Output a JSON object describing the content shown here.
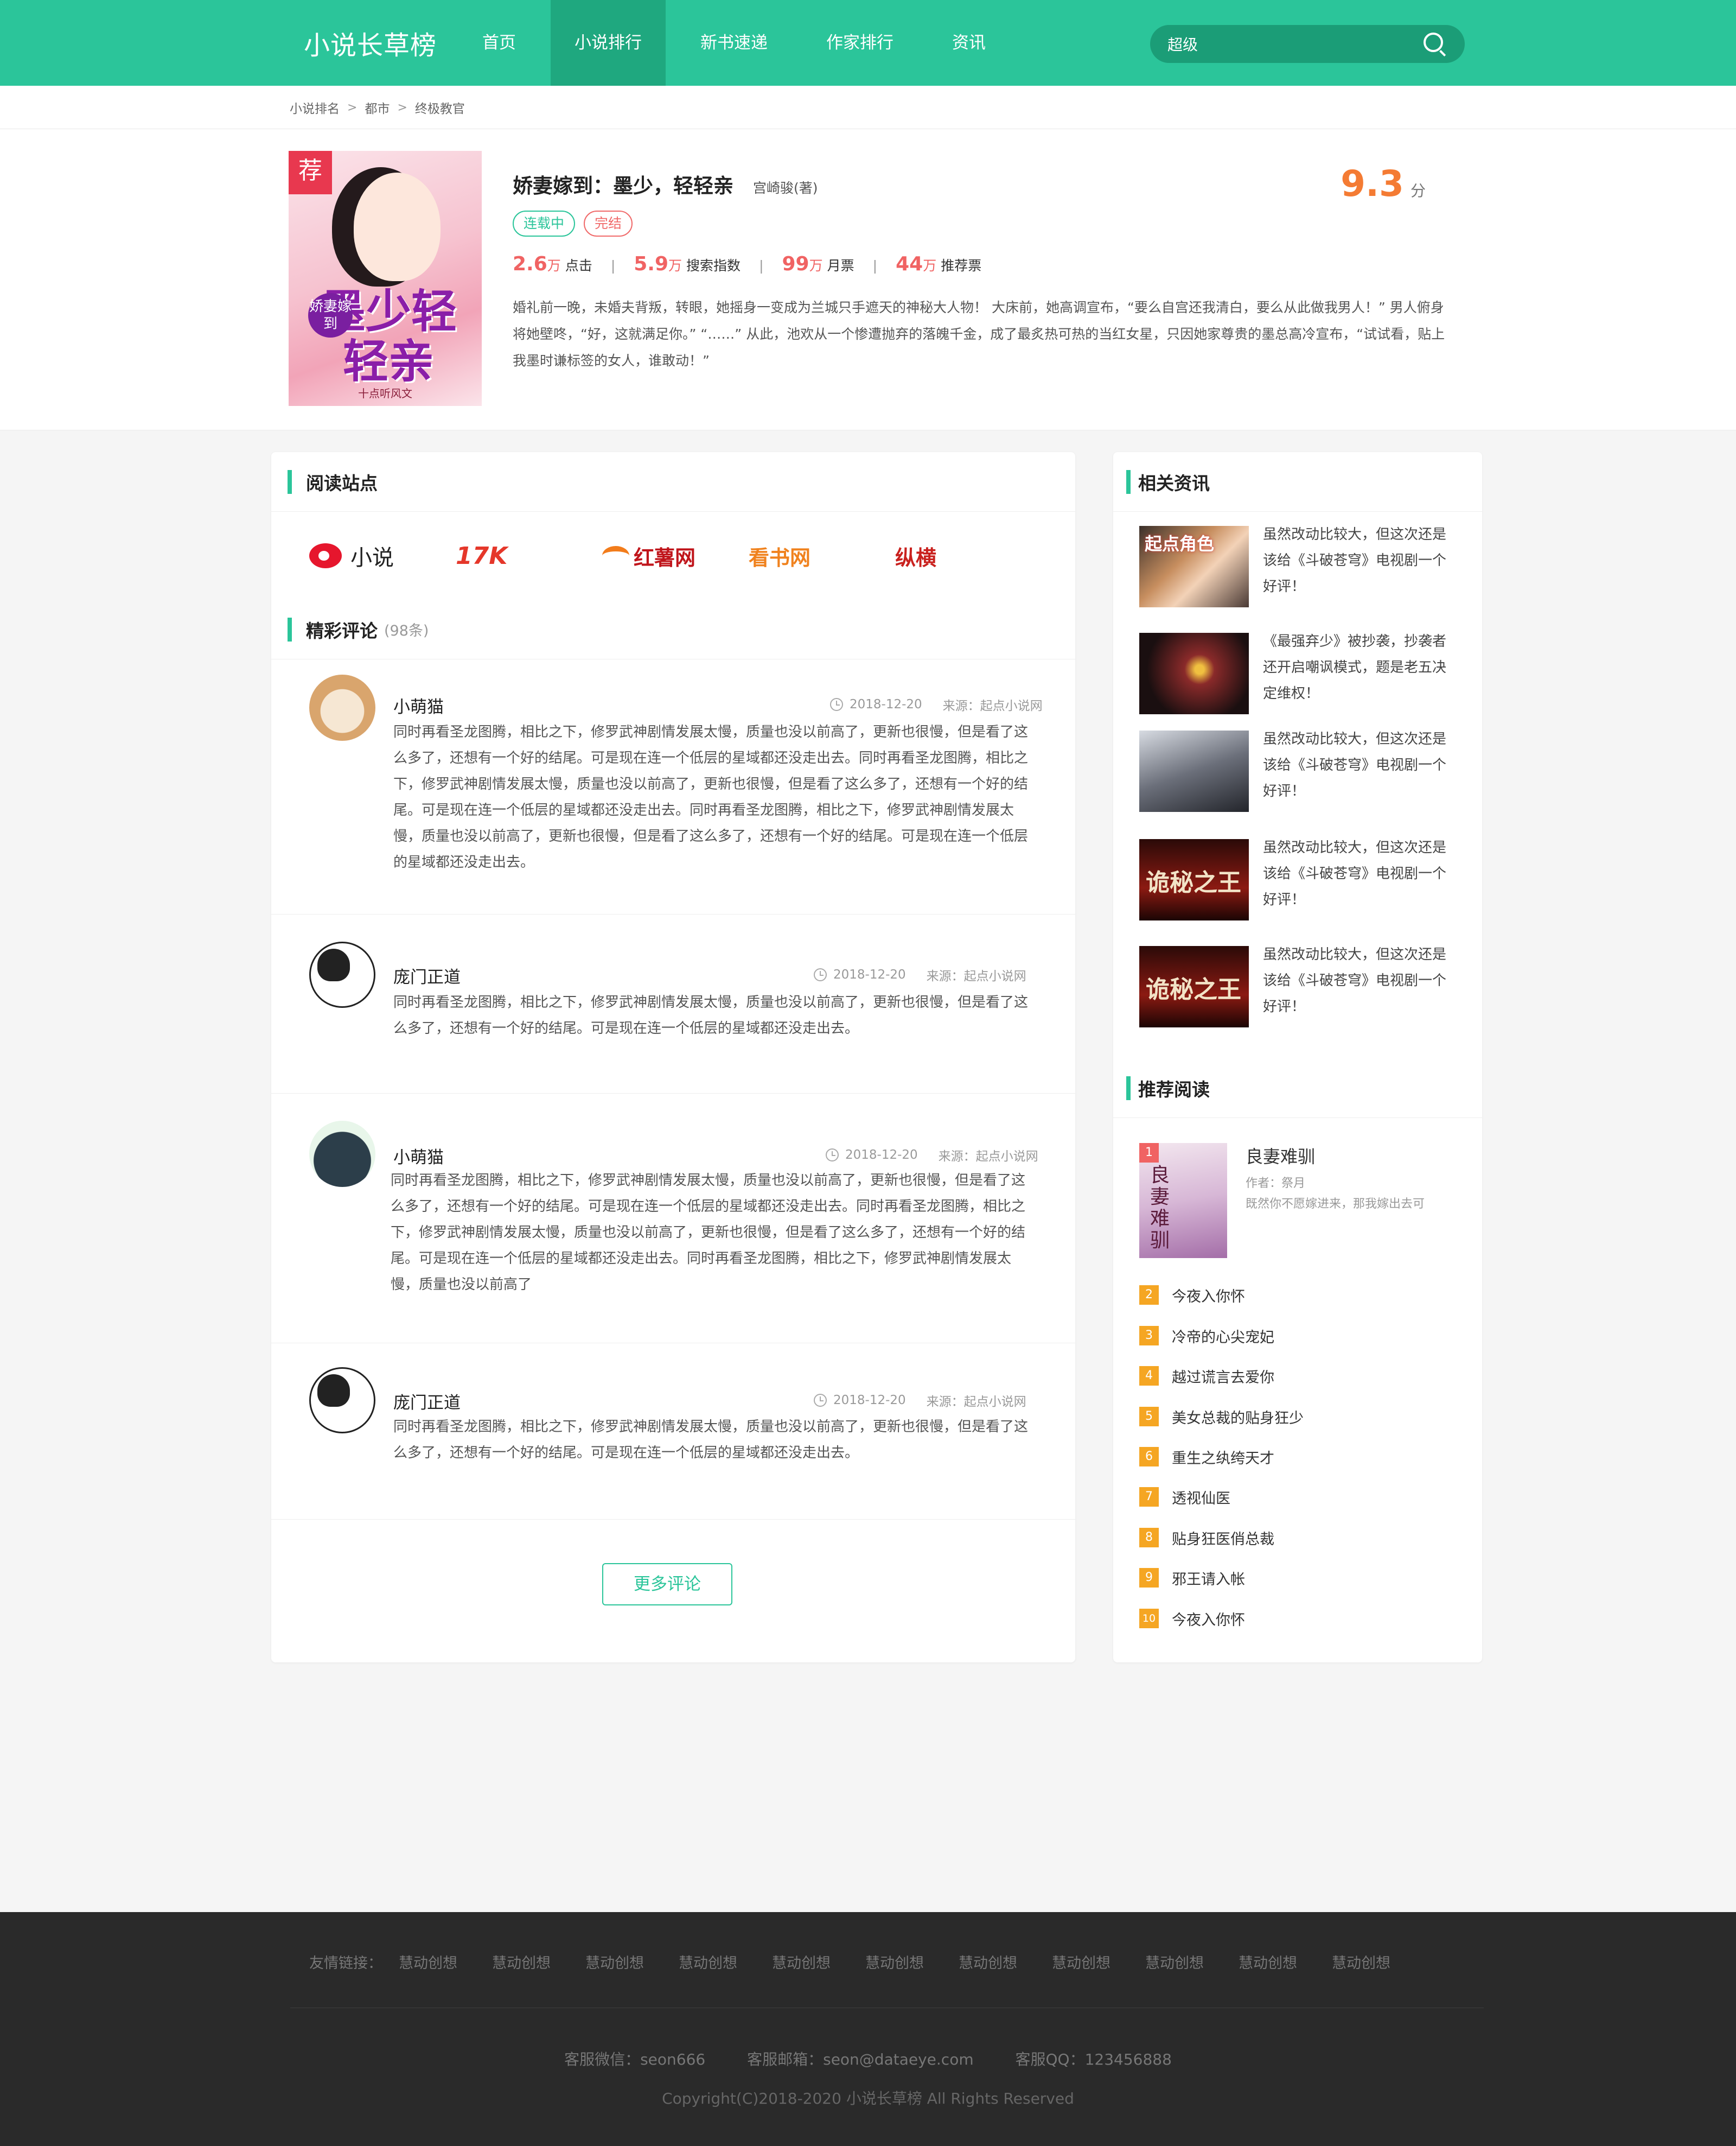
{
  "header": {
    "logo": "小说长草榜",
    "nav": [
      "首页",
      "小说排行",
      "新书速递",
      "作家排行",
      "资讯"
    ],
    "active_nav": "小说排行",
    "search_value": "超级"
  },
  "breadcrumb": [
    "小说排名",
    "都市",
    "终极教官"
  ],
  "book": {
    "cover_flag": "荐",
    "cover_title": "墨少轻轻亲",
    "cover_badge": "娇妻嫁到",
    "cover_foot": "十点听风文",
    "title": "娇妻嫁到：墨少，轻轻亲",
    "author": "宫崎骏(著)",
    "tags": [
      "连载中",
      "完结"
    ],
    "stats": [
      {
        "num": "2.6",
        "unit": "万",
        "label": "点击"
      },
      {
        "num": "5.9",
        "unit": "万",
        "label": "搜索指数"
      },
      {
        "num": "99",
        "unit": "万",
        "label": "月票"
      },
      {
        "num": "44",
        "unit": "万",
        "label": "推荐票"
      }
    ],
    "description": "婚礼前一晚，未婚夫背叛，转眼，她摇身一变成为兰城只手遮天的神秘大人物！ 大床前，她高调宣布，“要么自宫还我清白，要么从此做我男人！” 男人俯身将她壁咚，“好，这就满足你。” “……” 从此，池欢从一个惨遭抛弃的落魄千金，成了最炙热可热的当红女星，只因她家尊贵的墨总高冷宣布，“试试看，贴上我墨时谦标签的女人，谁敢动！”",
    "score": "9.3",
    "score_unit": "分"
  },
  "reading_sites": {
    "title": "阅读站点",
    "sites": [
      "小说",
      "17K",
      "红薯网",
      "看书网",
      "纵横"
    ]
  },
  "comments": {
    "title": "精彩评论",
    "count": "(98条)",
    "items": [
      {
        "name": "小萌猫",
        "date": "2018-12-20",
        "source": "来源：起点小说网",
        "text": "同时再看圣龙图腾，相比之下，修罗武神剧情发展太慢，质量也没以前高了，更新也很慢，但是看了这么多了，还想有一个好的结尾。可是现在连一个低层的星域都还没走出去。同时再看圣龙图腾，相比之下，修罗武神剧情发展太慢，质量也没以前高了，更新也很慢，但是看了这么多了，还想有一个好的结尾。可是现在连一个低层的星域都还没走出去。同时再看圣龙图腾，相比之下，修罗武神剧情发展太慢，质量也没以前高了，更新也很慢，但是看了这么多了，还想有一个好的结尾。可是现在连一个低层的星域都还没走出去。"
      },
      {
        "name": "庞门正道",
        "date": "2018-12-20",
        "source": "来源：起点小说网",
        "text": "同时再看圣龙图腾，相比之下，修罗武神剧情发展太慢，质量也没以前高了，更新也很慢，但是看了这么多了，还想有一个好的结尾。可是现在连一个低层的星域都还没走出去。"
      },
      {
        "name": "小萌猫",
        "date": "2018-12-20",
        "source": "来源：起点小说网",
        "text": "同时再看圣龙图腾，相比之下，修罗武神剧情发展太慢，质量也没以前高了，更新也很慢，但是看了这么多了，还想有一个好的结尾。可是现在连一个低层的星域都还没走出去。同时再看圣龙图腾，相比之下，修罗武神剧情发展太慢，质量也没以前高了，更新也很慢，但是看了这么多了，还想有一个好的结尾。可是现在连一个低层的星域都还没走出去。同时再看圣龙图腾，相比之下，修罗武神剧情发展太慢，质量也没以前高了"
      },
      {
        "name": "庞门正道",
        "date": "2018-12-20",
        "source": "来源：起点小说网",
        "text": "同时再看圣龙图腾，相比之下，修罗武神剧情发展太慢，质量也没以前高了，更新也很慢，但是看了这么多了，还想有一个好的结尾。可是现在连一个低层的星域都还没走出去。"
      }
    ],
    "more_label": "更多评论"
  },
  "news": {
    "title": "相关资讯",
    "items": [
      "虽然改动比较大，但这次还是该给《斗破苍穹》电视剧一个好评！",
      "《最强弃少》被抄袭，抄袭者还开启嘲讽模式，题是老五决定维权！",
      "虽然改动比较大，但这次还是该给《斗破苍穹》电视剧一个好评！",
      "虽然改动比较大，但这次还是该给《斗破苍穹》电视剧一个好评！",
      "虽然改动比较大，但这次还是该给《斗破苍穹》电视剧一个好评！"
    ]
  },
  "recommend": {
    "title": "推荐阅读",
    "top": {
      "rank": "1",
      "title": "良妻难驯",
      "author": "作者：祭月",
      "desc": "既然你不愿嫁进来，那我嫁出去可"
    },
    "items": [
      {
        "rank": "2",
        "title": "今夜入你怀"
      },
      {
        "rank": "3",
        "title": "冷帝的心尖宠妃"
      },
      {
        "rank": "4",
        "title": "越过谎言去爱你"
      },
      {
        "rank": "5",
        "title": "美女总裁的贴身狂少"
      },
      {
        "rank": "6",
        "title": "重生之纨绔天才"
      },
      {
        "rank": "7",
        "title": "透视仙医"
      },
      {
        "rank": "8",
        "title": "贴身狂医俏总裁"
      },
      {
        "rank": "9",
        "title": "邪王请入帐"
      },
      {
        "rank": "10",
        "title": "今夜入你怀"
      }
    ]
  },
  "footer": {
    "links_label": "友情链接：",
    "links": [
      "慧动创想",
      "慧动创想",
      "慧动创想",
      "慧动创想",
      "慧动创想",
      "慧动创想",
      "慧动创想",
      "慧动创想",
      "慧动创想",
      "慧动创想",
      "慧动创想"
    ],
    "contacts": [
      "客服微信：seon666",
      "客服邮箱：seon@dataeye.com",
      "客服QQ：123456888"
    ],
    "copyright": "Copyright(C)2018-2020 小说长草榜 All Rights Reserved"
  },
  "colors": {
    "brand": "#2bc59a",
    "accent_red": "#f06363",
    "score_orange": "#f47b33",
    "rank_orange": "#f5a623"
  }
}
